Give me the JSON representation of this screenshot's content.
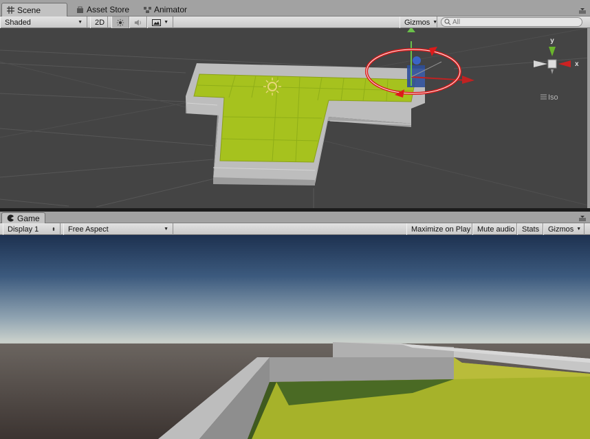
{
  "scene_panel": {
    "tabs": [
      {
        "label": "Scene",
        "icon": "grid-icon",
        "active": true
      },
      {
        "label": "Asset Store",
        "icon": "store-icon",
        "active": false
      },
      {
        "label": "Animator",
        "icon": "animator-icon",
        "active": false
      }
    ],
    "toolbar": {
      "shading_mode": "Shaded",
      "mode_2d": "2D",
      "gizmos_label": "Gizmos",
      "search_placeholder": "All"
    },
    "orientation_gizmo": {
      "y_label": "y",
      "x_label": "x",
      "projection_label": "Iso"
    }
  },
  "game_panel": {
    "tab": {
      "label": "Game",
      "icon": "pacman-icon"
    },
    "toolbar": {
      "display": "Display 1",
      "aspect": "Free Aspect",
      "maximize_label": "Maximize on Play",
      "mute_label": "Mute audio",
      "stats_label": "Stats",
      "gizmos_label": "Gizmos"
    }
  },
  "colors": {
    "ground_green": "#a6c21e",
    "wall_gray": "#b6b6b6",
    "rotate_gizmo_red": "#dd1a1a",
    "sky_top": "#1d3150",
    "horizon": "#c9d0cb"
  }
}
